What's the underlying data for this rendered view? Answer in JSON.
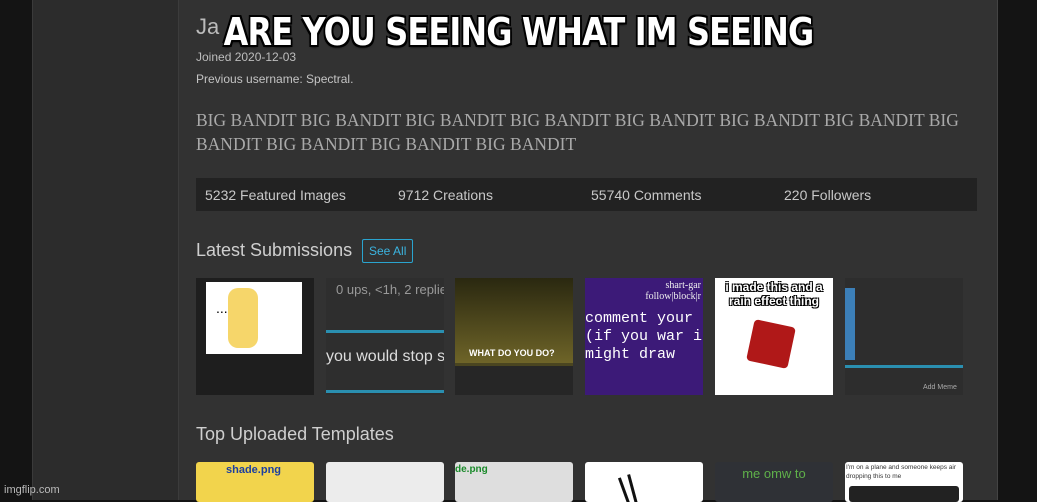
{
  "meme_caption": "ARE YOU SEEING WHAT IM SEEING",
  "watermark": "imgflip.com",
  "profile": {
    "username_partial": "Ja",
    "joined": "Joined 2020-12-03",
    "previous_username": "Previous username: Spectral.",
    "bio": "BIG BANDIT BIG BANDIT BIG BANDIT BIG BANDIT BIG BANDIT BIG BANDIT BIG BANDIT BIG BANDIT BIG BANDIT BIG BANDIT BIG BANDIT",
    "stats": [
      "5232 Featured Images",
      "9712 Creations",
      "55740 Comments",
      "220 Followers"
    ]
  },
  "latest": {
    "title": "Latest Submissions",
    "see_all": "See All",
    "items": [
      {
        "text": "..."
      },
      {
        "text": "0 ups, <1h, 2 replie",
        "text2": "you would stop s"
      },
      {
        "text": "WHAT DO YOU DO?"
      },
      {
        "text": "shart-gar follow|block|r",
        "text2": "comment your (if you war i might draw"
      },
      {
        "text": "i made this and a rain effect thing"
      },
      {
        "text": "Add Meme"
      }
    ]
  },
  "templates": {
    "title": "Top Uploaded Templates",
    "items": [
      "shade.png",
      "",
      "de.png",
      "",
      "me omw to",
      "I'm on a plane and someone keeps air dropping this to me"
    ]
  },
  "colors": {
    "accent": "#2aa4cf",
    "background": "#323232"
  }
}
